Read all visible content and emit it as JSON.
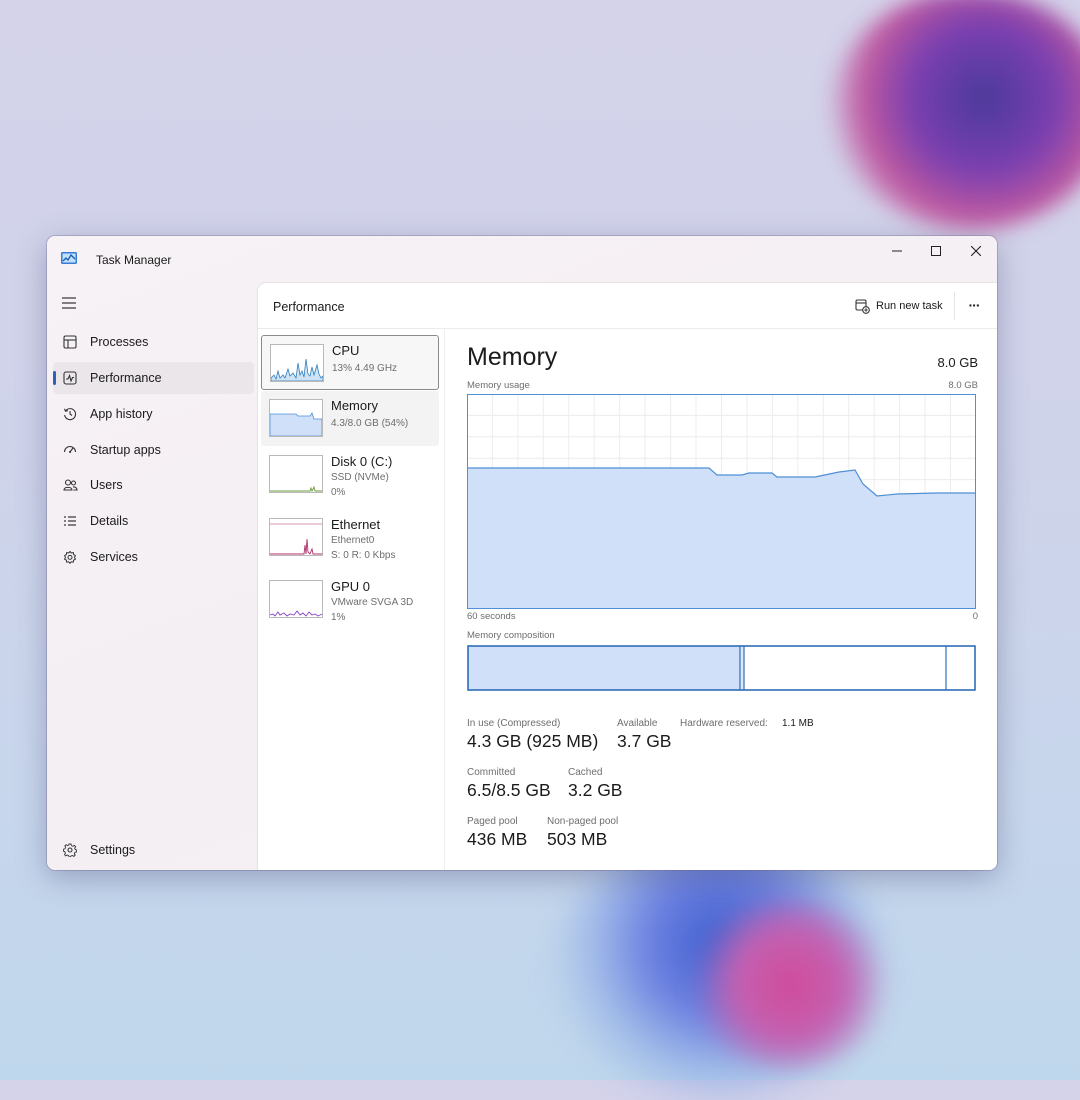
{
  "window": {
    "title": "Task Manager",
    "controls": {
      "minimize": "—",
      "maximize": "□",
      "close": "✕"
    }
  },
  "sidebar": {
    "items": [
      {
        "label": "Processes",
        "icon": "processes-icon"
      },
      {
        "label": "Performance",
        "icon": "performance-icon",
        "active": true
      },
      {
        "label": "App history",
        "icon": "history-icon"
      },
      {
        "label": "Startup apps",
        "icon": "startup-icon"
      },
      {
        "label": "Users",
        "icon": "users-icon"
      },
      {
        "label": "Details",
        "icon": "details-icon"
      },
      {
        "label": "Services",
        "icon": "services-icon"
      }
    ],
    "settings_label": "Settings"
  },
  "header": {
    "title": "Performance",
    "run_task_label": "Run new task",
    "more_label": "···"
  },
  "devices": [
    {
      "name": "CPU",
      "line1": "13%  4.49 GHz",
      "line2": ""
    },
    {
      "name": "Memory",
      "line1": "4.3/8.0 GB (54%)",
      "line2": ""
    },
    {
      "name": "Disk 0 (C:)",
      "line1": "SSD (NVMe)",
      "line2": "0%"
    },
    {
      "name": "Ethernet",
      "line1": "Ethernet0",
      "line2": "S: 0  R: 0 Kbps"
    },
    {
      "name": "GPU 0",
      "line1": "VMware SVGA 3D",
      "line2": "1%"
    }
  ],
  "memory": {
    "title": "Memory",
    "total": "8.0 GB",
    "usage_label": "Memory usage",
    "usage_max": "8.0 GB",
    "time_label": "60 seconds",
    "time_end": "0",
    "composition_label": "Memory composition",
    "stats": {
      "in_use_label": "In use (Compressed)",
      "in_use_value": "4.3 GB (925 MB)",
      "available_label": "Available",
      "available_value": "3.7 GB",
      "hw_reserved_label": "Hardware reserved:",
      "hw_reserved_value": "1.1 MB",
      "committed_label": "Committed",
      "committed_value": "6.5/8.5 GB",
      "cached_label": "Cached",
      "cached_value": "3.2 GB",
      "paged_label": "Paged pool",
      "paged_value": "436 MB",
      "nonpaged_label": "Non-paged pool",
      "nonpaged_value": "503 MB"
    }
  },
  "colors": {
    "memory_fill": "#cfe0f8",
    "memory_line": "#4f8fd6",
    "cpu_line": "#2f7fbf",
    "disk_line": "#6b9b3a",
    "ethernet_line": "#b0306a",
    "gpu_line": "#8a40c8",
    "accent": "#2e62b8"
  }
}
